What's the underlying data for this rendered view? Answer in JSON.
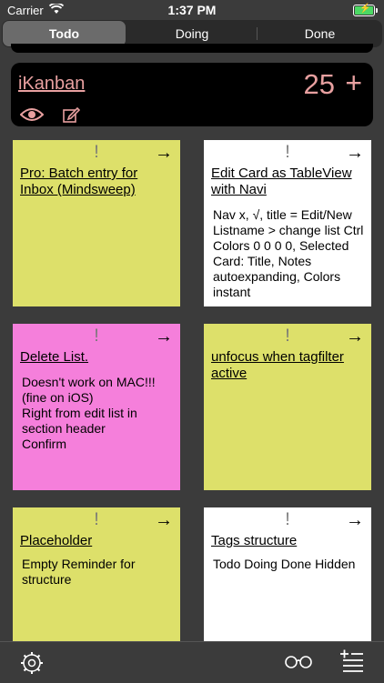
{
  "status_bar": {
    "carrier": "Carrier",
    "time": "1:37 PM"
  },
  "segments": [
    "Todo",
    "Doing",
    "Done"
  ],
  "selected_segment": "Todo",
  "header": {
    "title": "iKanban",
    "count": "25",
    "add_symbol": "+"
  },
  "cards": [
    {
      "title": "Pro: Batch entry for Inbox (Mindsweep)",
      "notes": "",
      "color": "#dde06a"
    },
    {
      "title": "Edit Card as TableView with Navi",
      "notes": "Nav x, √, title = Edit/New\nListname > change list Ctrl\nColors 0 0 0 0, Selected Card: Title, Notes autoexpanding, Colors instant",
      "color": "#ffffff"
    },
    {
      "title": "Delete List.",
      "notes": "Doesn't work on MAC!!! (fine on iOS)\nRight from edit list in section header\nConfirm",
      "color": "#f57fdb"
    },
    {
      "title": "unfocus when tagfilter active",
      "notes": "",
      "color": "#dde06a"
    },
    {
      "title": "Placeholder",
      "notes": "Empty Reminder for structure",
      "color": "#dde06a"
    },
    {
      "title": "Tags structure",
      "notes": "Todo Doing Done Hidden",
      "color": "#ffffff"
    }
  ],
  "card_marks": {
    "priority": "!",
    "move_arrow": "→"
  },
  "colors": {
    "background": "#3b3b3b",
    "header_text": "#e8a0a0",
    "accent_battery": "#4cd964"
  }
}
